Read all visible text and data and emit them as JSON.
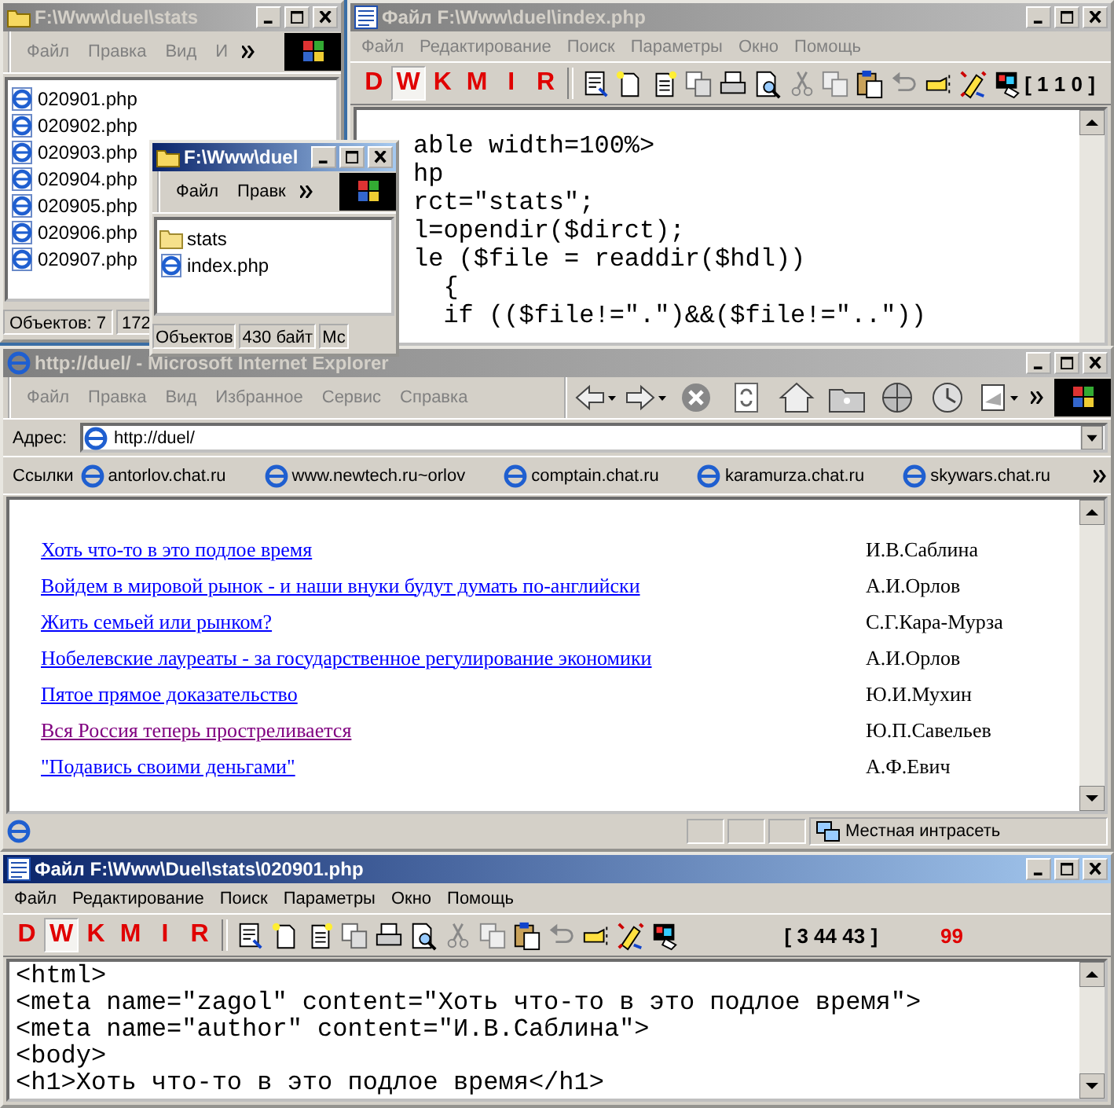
{
  "explorer_stats": {
    "title": "F:\\Www\\duel\\stats",
    "active": false,
    "menu": [
      "Файл",
      "Правка",
      "Вид",
      "И"
    ],
    "files": [
      "020901.php",
      "020902.php",
      "020903.php",
      "020904.php",
      "020905.php",
      "020906.php",
      "020907.php"
    ],
    "status": [
      "Объектов: 7",
      "172"
    ]
  },
  "editor_index": {
    "title": "Файл F:\\Www\\duel\\index.php",
    "active": false,
    "menu": [
      "Файл",
      "Редактирование",
      "Поиск",
      "Параметры",
      "Окно",
      "Помощь"
    ],
    "tools": [
      {
        "label": "D",
        "selected": false
      },
      {
        "label": "W",
        "selected": true
      },
      {
        "label": "K",
        "selected": false
      },
      {
        "label": "M",
        "selected": false
      },
      {
        "label": "I",
        "selected": false
      },
      {
        "label": "R",
        "selected": false
      }
    ],
    "position": "[ 1 1 0 ]",
    "code": [
      "able width=100%>",
      "hp",
      "rct=\"stats\";",
      "l=opendir($dirct);",
      "le ($file = readdir($hdl))",
      "  {",
      "  if (($file!=\".\")&&($file!=\"..\"))"
    ]
  },
  "explorer_duel": {
    "title": "F:\\Www\\duel",
    "active": true,
    "menu": [
      "Файл",
      "Правк"
    ],
    "items": [
      {
        "name": "stats",
        "kind": "folder"
      },
      {
        "name": "index.php",
        "kind": "page"
      }
    ],
    "status": [
      "Объектов",
      "430 байт",
      "Мс"
    ]
  },
  "browser": {
    "title": "http://duel/ - Microsoft Internet Explorer",
    "active": false,
    "menu": [
      "Файл",
      "Правка",
      "Вид",
      "Избранное",
      "Сервис",
      "Справка"
    ],
    "address_label": "Адрес:",
    "address": "http://duel/",
    "links_label": "Ссылки",
    "links": [
      "antorlov.chat.ru",
      "www.newtech.ru~orlov",
      "comptain.chat.ru",
      "karamurza.chat.ru",
      "skywars.chat.ru"
    ],
    "articles": [
      {
        "title": "Хоть что-то в это подлое время",
        "author": "И.В.Саблина",
        "visited": false
      },
      {
        "title": "Войдем в мировой рынок - и наши внуки будут думать по-английски",
        "author": "А.И.Орлов",
        "visited": false
      },
      {
        "title": "Жить семьей или рынком?",
        "author": "С.Г.Кара-Мурза",
        "visited": false
      },
      {
        "title": "Нобелевские лауреаты - за государственное регулирование экономики",
        "author": "А.И.Орлов",
        "visited": false
      },
      {
        "title": "Пятое прямое доказательство",
        "author": "Ю.И.Мухин",
        "visited": false
      },
      {
        "title": "Вся Россия теперь простреливается",
        "author": "Ю.П.Савельев",
        "visited": true
      },
      {
        "title": "\"Подавись своими деньгами\"",
        "author": "А.Ф.Евич",
        "visited": false
      }
    ],
    "status": "Местная интрасеть"
  },
  "editor_file": {
    "title": "Файл F:\\Www\\Duel\\stats\\020901.php",
    "active": true,
    "menu": [
      "Файл",
      "Редактирование",
      "Поиск",
      "Параметры",
      "Окно",
      "Помощь"
    ],
    "tools": [
      {
        "label": "D",
        "selected": false
      },
      {
        "label": "W",
        "selected": true
      },
      {
        "label": "K",
        "selected": false
      },
      {
        "label": "M",
        "selected": false
      },
      {
        "label": "I",
        "selected": false
      },
      {
        "label": "R",
        "selected": false
      }
    ],
    "position": "[ 3 44 43 ]",
    "counter": "99",
    "code": [
      "<html>",
      "<meta name=\"zagol\" content=\"Хоть что-то в это подлое время\">",
      "<meta name=\"author\" content=\"И.В.Саблина\">",
      "<body>",
      "<h1>Хоть что-то в это подлое время</h1>"
    ]
  }
}
